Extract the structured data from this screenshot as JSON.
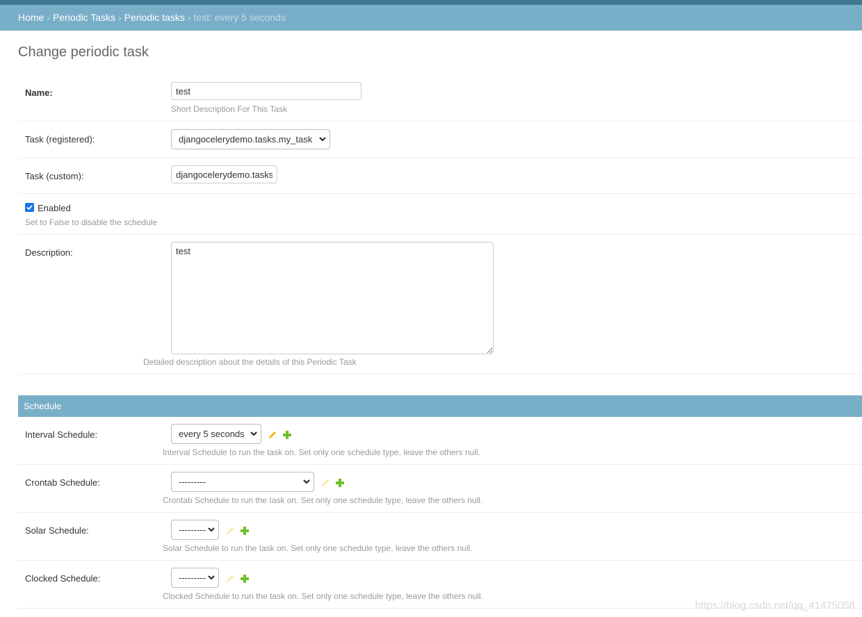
{
  "breadcrumbs": {
    "home": "Home",
    "app": "Periodic Tasks",
    "model": "Periodic tasks",
    "current": "test: every 5 seconds",
    "separator": "›"
  },
  "page_title": "Change periodic task",
  "fields": {
    "name": {
      "label": "Name:",
      "value": "test",
      "help": "Short Description For This Task"
    },
    "task_registered": {
      "label": "Task (registered):",
      "value": "djangocelerydemo.tasks.my_task"
    },
    "task_custom": {
      "label": "Task (custom):",
      "value": "djangocelerydemo.tasks"
    },
    "enabled": {
      "label": "Enabled",
      "checked": true,
      "help": "Set to False to disable the schedule"
    },
    "description": {
      "label": "Description:",
      "value": "test",
      "help": "Detailed description about the details of this Periodic Task"
    }
  },
  "schedule": {
    "caption": "Schedule",
    "interval": {
      "label": "Interval Schedule:",
      "value": "every 5 seconds",
      "help": "Interval Schedule to run the task on. Set only one schedule type, leave the others null."
    },
    "crontab": {
      "label": "Crontab Schedule:",
      "value": "---------",
      "help": "Crontab Schedule to run the task on. Set only one schedule type, leave the others null."
    },
    "solar": {
      "label": "Solar Schedule:",
      "value": "---------",
      "help": "Solar Schedule to run the task on. Set only one schedule type, leave the others null."
    },
    "clocked": {
      "label": "Clocked Schedule:",
      "value": "---------",
      "help": "Clocked Schedule to run the task on. Set only one schedule type, leave the others null."
    }
  },
  "icons": {
    "edit": "pencil-icon",
    "add": "plus-icon",
    "dropdown": "chevron-down-icon"
  },
  "colors": {
    "header": "#417690",
    "breadcrumb_bar": "#79aec8",
    "add_icon": "#70bf2b",
    "edit_icon": "#efb80b"
  },
  "watermark": "https://blog.csdn.net/qq_41475058"
}
